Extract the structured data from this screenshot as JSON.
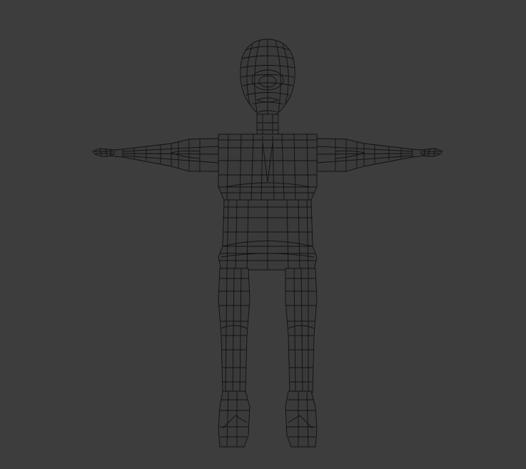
{
  "viewport": {
    "background_color": "#3d3d3d",
    "wire_color": "#111111",
    "display_mode": "wireframe"
  },
  "model": {
    "pose": "T-pose",
    "parts": [
      "head",
      "neck",
      "torso",
      "hips",
      "left-arm",
      "right-arm",
      "left-hand",
      "right-hand",
      "left-leg",
      "right-leg",
      "left-foot",
      "right-foot"
    ]
  }
}
